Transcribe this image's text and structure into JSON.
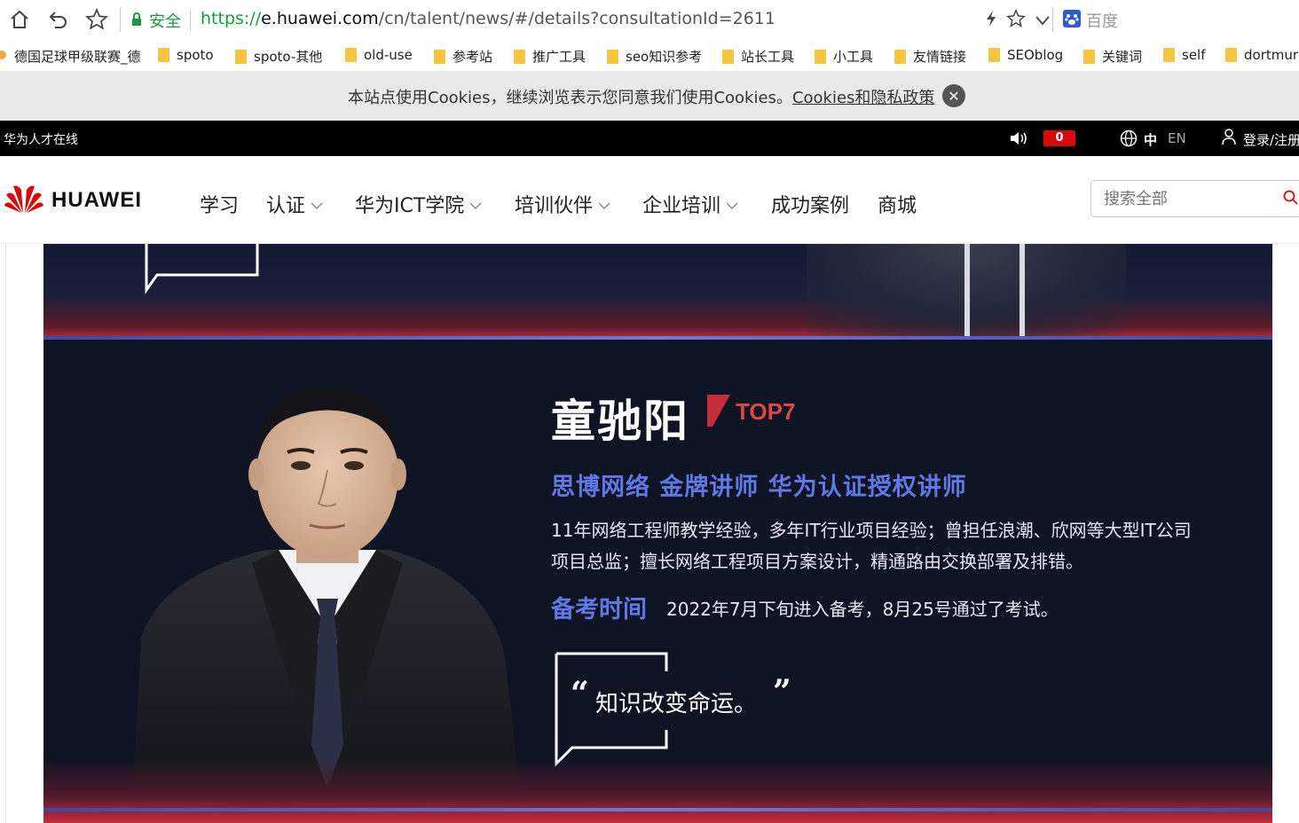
{
  "browser": {
    "security_label": "安全",
    "url_protocol": "https://",
    "url_host": "e.huawei.com",
    "url_path": "/cn/talent/news/#/details?consultationId=2611",
    "search_engine": "百度"
  },
  "bookmarks": [
    {
      "label": "德国足球甲级联赛_德"
    },
    {
      "label": "spoto"
    },
    {
      "label": "spoto-其他"
    },
    {
      "label": "old-use"
    },
    {
      "label": "参考站"
    },
    {
      "label": "推广工具"
    },
    {
      "label": "seo知识参考"
    },
    {
      "label": "站长工具"
    },
    {
      "label": "小工具"
    },
    {
      "label": "友情链接"
    },
    {
      "label": "SEOblog"
    },
    {
      "label": "关键词"
    },
    {
      "label": "self"
    },
    {
      "label": "dortmur"
    }
  ],
  "cookie": {
    "text": "本站点使用Cookies，继续浏览表示您同意我们使用Cookies。",
    "link": "Cookies和隐私政策"
  },
  "topbar": {
    "site_name": "华为人才在线",
    "message_count": "0",
    "lang_zh": "中",
    "lang_en": "EN",
    "login": "登录/注册"
  },
  "nav": {
    "logo_text": "HUAWEI",
    "items": [
      {
        "label": "学习"
      },
      {
        "label": "认证"
      },
      {
        "label": "华为ICT学院"
      },
      {
        "label": "培训伙伴"
      },
      {
        "label": "企业培训"
      },
      {
        "label": "成功案例"
      },
      {
        "label": "商城"
      }
    ],
    "search_placeholder": "搜索全部"
  },
  "profile": {
    "name": "童驰阳",
    "rank": "TOP7",
    "title": "思博网络 金牌讲师 华为认证授权讲师",
    "description": "11年网络工程师教学经验，多年IT行业项目经验；曾担任浪潮、欣网等大型IT公司项目总监；擅长网络工程项目方案设计，精通路由交换部署及排错。",
    "prep_label": "备考时间",
    "prep_text": "2022年7月下旬进入备考，8月25号通过了考试。",
    "quote": "知识改变命运。"
  },
  "colors": {
    "accent_blue": "#5f78e6",
    "huawei_red": "#d60a0a",
    "banner_bg": "#0f1425",
    "secure_green": "#1a9c3e"
  }
}
